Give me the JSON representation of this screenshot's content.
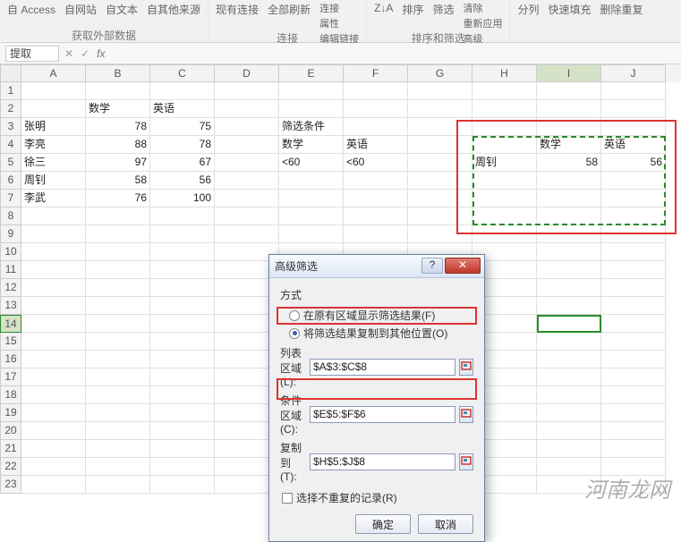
{
  "ribbon": {
    "group1": {
      "items": [
        "自 Access",
        "自网站",
        "自文本",
        "自其他来源"
      ],
      "label": "获取外部数据"
    },
    "group2": {
      "items": [
        "现有连接",
        "全部刷新"
      ],
      "sub": [
        "连接",
        "属性",
        "编辑链接"
      ],
      "label": "连接"
    },
    "group3": {
      "items": [
        "Z↓A",
        "排序",
        "筛选"
      ],
      "sub": [
        "清除",
        "重新应用",
        "高级"
      ],
      "label": "排序和筛选"
    },
    "group4": {
      "items": [
        "分列",
        "快速填充",
        "删除重复"
      ],
      "label": ""
    }
  },
  "formula_bar": {
    "name": "提取",
    "fx": "fx"
  },
  "columns": [
    "A",
    "B",
    "C",
    "D",
    "E",
    "F",
    "G",
    "H",
    "I",
    "J"
  ],
  "sheet": {
    "row2": {
      "B": "数学",
      "C": "英语"
    },
    "row3": {
      "A": "张明",
      "B": "78",
      "C": "75",
      "E": "筛选条件"
    },
    "row4": {
      "A": "李亮",
      "B": "88",
      "C": "78",
      "E": "数学",
      "F": "英语",
      "I": "数学",
      "J": "英语"
    },
    "row5": {
      "A": "徐三",
      "B": "97",
      "C": "67",
      "E": "<60",
      "F": "<60",
      "H": "周钊",
      "I": "58",
      "J": "56"
    },
    "row6": {
      "A": "周钊",
      "B": "58",
      "C": "56"
    },
    "row7": {
      "A": "李武",
      "B": "76",
      "C": "100"
    }
  },
  "dialog": {
    "title": "高级筛选",
    "group": "方式",
    "opt1": "在原有区域显示筛选结果(F)",
    "opt2": "将筛选结果复制到其他位置(O)",
    "list_label": "列表区域(L):",
    "list_val": "$A$3:$C$8",
    "crit_label": "条件区域(C):",
    "crit_val": "$E$5:$F$6",
    "copy_label": "复制到(T):",
    "copy_val": "$H$5:$J$8",
    "unique": "选择不重复的记录(R)",
    "ok": "确定",
    "cancel": "取消"
  },
  "watermark": "河南龙网"
}
